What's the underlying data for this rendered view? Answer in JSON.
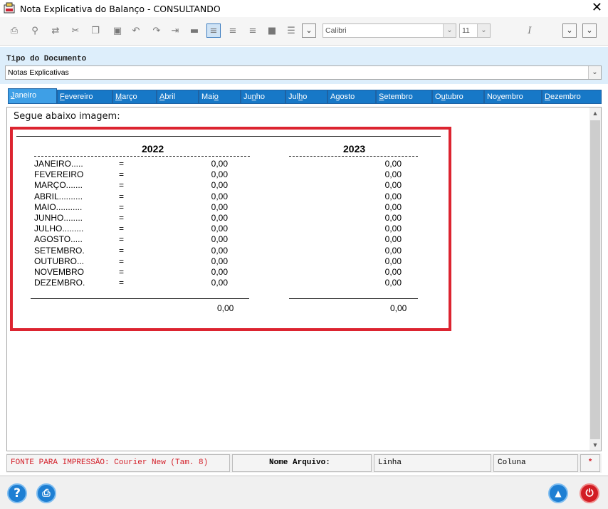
{
  "window": {
    "title": "Nota Explicativa do Balanço  -  CONSULTANDO",
    "close_glyph": "✕"
  },
  "toolbar": {
    "font_name": "Calibri",
    "font_size": "11",
    "italic_glyph": "I"
  },
  "document": {
    "label": "Tipo do Documento",
    "value": "Notas Explicativas"
  },
  "tabs": [
    {
      "pre": "",
      "ul": "J",
      "post": "aneiro"
    },
    {
      "pre": "",
      "ul": "F",
      "post": "evereiro"
    },
    {
      "pre": "",
      "ul": "M",
      "post": "arço"
    },
    {
      "pre": "",
      "ul": "A",
      "post": "bril"
    },
    {
      "pre": "Mai",
      "ul": "o",
      "post": ""
    },
    {
      "pre": "Ju",
      "ul": "n",
      "post": "ho"
    },
    {
      "pre": "Jul",
      "ul": "h",
      "post": "o"
    },
    {
      "pre": "A",
      "ul": "g",
      "post": "osto"
    },
    {
      "pre": "",
      "ul": "S",
      "post": "etembro"
    },
    {
      "pre": "O",
      "ul": "u",
      "post": "tubro"
    },
    {
      "pre": "No",
      "ul": "v",
      "post": "embro"
    },
    {
      "pre": "",
      "ul": "D",
      "post": "ezembro"
    }
  ],
  "content": {
    "intro": "Segue abaixo imagem:",
    "year_left": "2022",
    "year_right": "2023",
    "rows": [
      {
        "month": "JANEIRO.....",
        "eq": "=",
        "v2022": "0,00",
        "v2023": "0,00"
      },
      {
        "month": "FEVEREIRO",
        "eq": "=",
        "v2022": "0,00",
        "v2023": "0,00"
      },
      {
        "month": "MARÇO.......",
        "eq": "=",
        "v2022": "0,00",
        "v2023": "0,00"
      },
      {
        "month": "ABRIL..........",
        "eq": "=",
        "v2022": "0,00",
        "v2023": "0,00"
      },
      {
        "month": "MAIO...........",
        "eq": "=",
        "v2022": "0,00",
        "v2023": "0,00"
      },
      {
        "month": "JUNHO........",
        "eq": "=",
        "v2022": "0,00",
        "v2023": "0,00"
      },
      {
        "month": "JULHO.........",
        "eq": "=",
        "v2022": "0,00",
        "v2023": "0,00"
      },
      {
        "month": "AGOSTO.....",
        "eq": "=",
        "v2022": "0,00",
        "v2023": "0,00"
      },
      {
        "month": "SETEMBRO.",
        "eq": "=",
        "v2022": "0,00",
        "v2023": "0,00"
      },
      {
        "month": "OUTUBRO...",
        "eq": "=",
        "v2022": "0,00",
        "v2023": "0,00"
      },
      {
        "month": "NOVEMBRO",
        "eq": "=",
        "v2022": "0,00",
        "v2023": "0,00"
      },
      {
        "month": "DEZEMBRO.",
        "eq": "=",
        "v2022": "0,00",
        "v2023": "0,00"
      }
    ],
    "total_2022": "0,00",
    "total_2023": "0,00"
  },
  "status": {
    "font_info": "FONTE PARA IMPRESSÃO: Courier New (Tam. 8)",
    "file_label": "Nome Arquivo:",
    "line_label": "Linha",
    "column_label": "Coluna",
    "marker": "*"
  },
  "bottom": {
    "help_glyph": "?",
    "print_glyph": "⎙",
    "up_glyph": "▲",
    "power_glyph": "⏻"
  },
  "colors": {
    "tab_blue": "#1778c7",
    "frame_red": "#dc2430",
    "status_red": "#d3202a"
  }
}
